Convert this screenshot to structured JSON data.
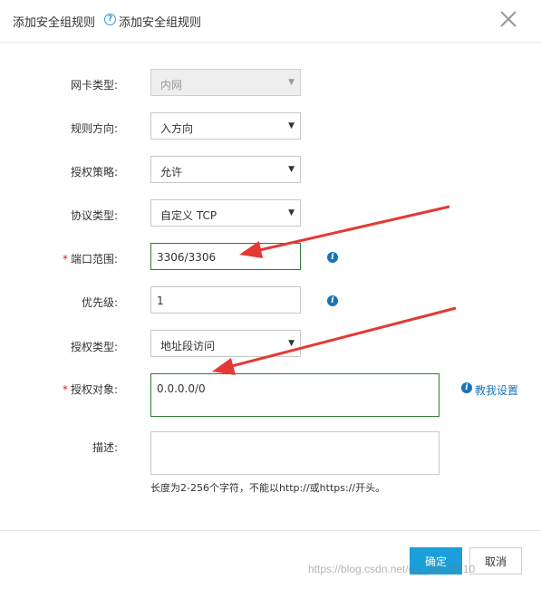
{
  "dialog": {
    "title": "添加安全组规则",
    "help_icon": "?",
    "help_label": "添加安全组规则",
    "close_icon": "close-icon"
  },
  "form": {
    "nic_type": {
      "label": "网卡类型:",
      "value": "内网",
      "disabled": true
    },
    "direction": {
      "label": "规则方向:",
      "value": "入方向"
    },
    "policy": {
      "label": "授权策略:",
      "value": "允许"
    },
    "protocol": {
      "label": "协议类型:",
      "value": "自定义 TCP"
    },
    "port_range": {
      "label": "端口范围:",
      "required": "*",
      "value": "3306/3306",
      "info_icon": "i"
    },
    "priority": {
      "label": "优先级:",
      "value": "1",
      "info_icon": "i"
    },
    "auth_type": {
      "label": "授权类型:",
      "value": "地址段访问"
    },
    "auth_object": {
      "label": "授权对象:",
      "required": "*",
      "value": "0.0.0.0/0",
      "teach_link": "教我设置",
      "info_icon": "i"
    },
    "description": {
      "label": "描述:",
      "value": "",
      "hint": "长度为2-256个字符，不能以http://或https://开头。"
    },
    "select_arrow": "▼"
  },
  "footer": {
    "ok_label": "确定",
    "cancel_label": "取消"
  },
  "watermark": "https://blog.csdn.net/qq_34978710",
  "colors": {
    "accent": "#1a9fd8",
    "link": "#1a73b8",
    "required": "#e02020",
    "highlight_border": "#2e7d32",
    "annotation_arrow": "#e53935"
  }
}
